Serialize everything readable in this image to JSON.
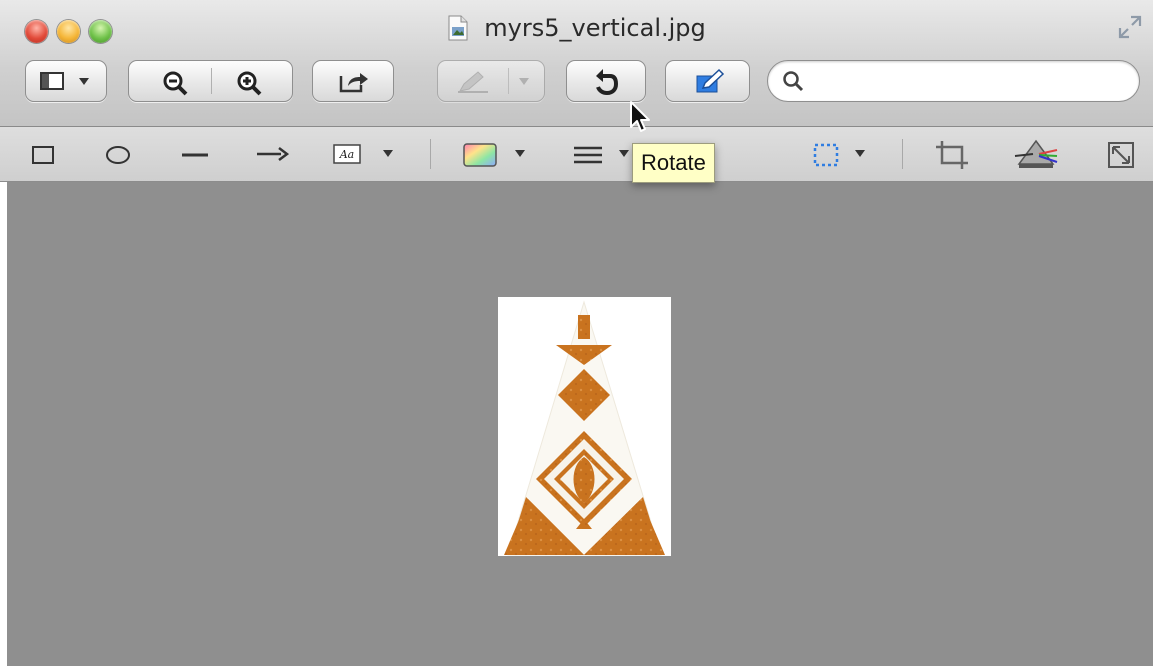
{
  "window": {
    "title": "myrs5_vertical.jpg"
  },
  "toolbar": {
    "view_menu": "sidebar-view-menu",
    "zoom_out": "zoom-out",
    "zoom_in": "zoom-in",
    "share": "share",
    "annotate": "annotate",
    "rotate": "rotate",
    "markup": "markup-toolbar-toggle"
  },
  "search": {
    "value": "",
    "placeholder": ""
  },
  "tooltip": {
    "text": "Rotate"
  },
  "colors": {
    "accent_blue": "#2f7de1",
    "image_orange": "#c9731f",
    "canvas_gray": "#8f8f8f",
    "tooltip_yellow": "#ffffc6"
  },
  "icons": [
    "close-button",
    "minimize-button",
    "zoom-button",
    "document-icon",
    "fullscreen-icon",
    "sidebar-icon",
    "zoom-out-icon",
    "zoom-in-icon",
    "share-icon",
    "pen-icon",
    "rotate-icon",
    "markup-icon",
    "search-icon",
    "rectangle-icon",
    "oval-icon",
    "line-icon",
    "arrow-icon",
    "text-box-icon",
    "color-icon",
    "line-width-icon",
    "selection-icon",
    "crop-icon",
    "adjust-color-icon",
    "resize-icon",
    "cursor-arrow"
  ]
}
